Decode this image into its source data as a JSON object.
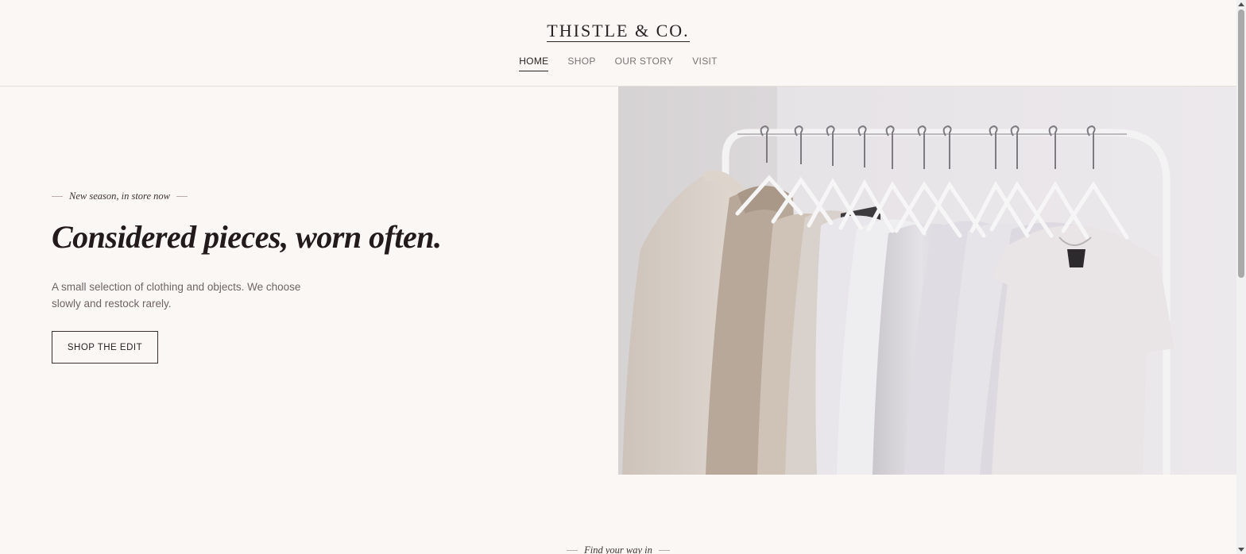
{
  "header": {
    "brand": "THISTLE & CO.",
    "nav": [
      {
        "label": "HOME",
        "active": true
      },
      {
        "label": "SHOP",
        "active": false
      },
      {
        "label": "OUR STORY",
        "active": false
      },
      {
        "label": "VISIT",
        "active": false
      }
    ]
  },
  "hero": {
    "eyebrow": "New season, in store now",
    "headline": "Considered pieces, worn often.",
    "lede": "A small selection of clothing and objects. We choose slowly and restock rarely.",
    "cta_label": "SHOP THE EDIT"
  },
  "next_section": {
    "eyebrow": "Find your way in"
  },
  "colors": {
    "background": "#fbf7f4",
    "text": "#2a2222",
    "muted": "#6e6464"
  }
}
